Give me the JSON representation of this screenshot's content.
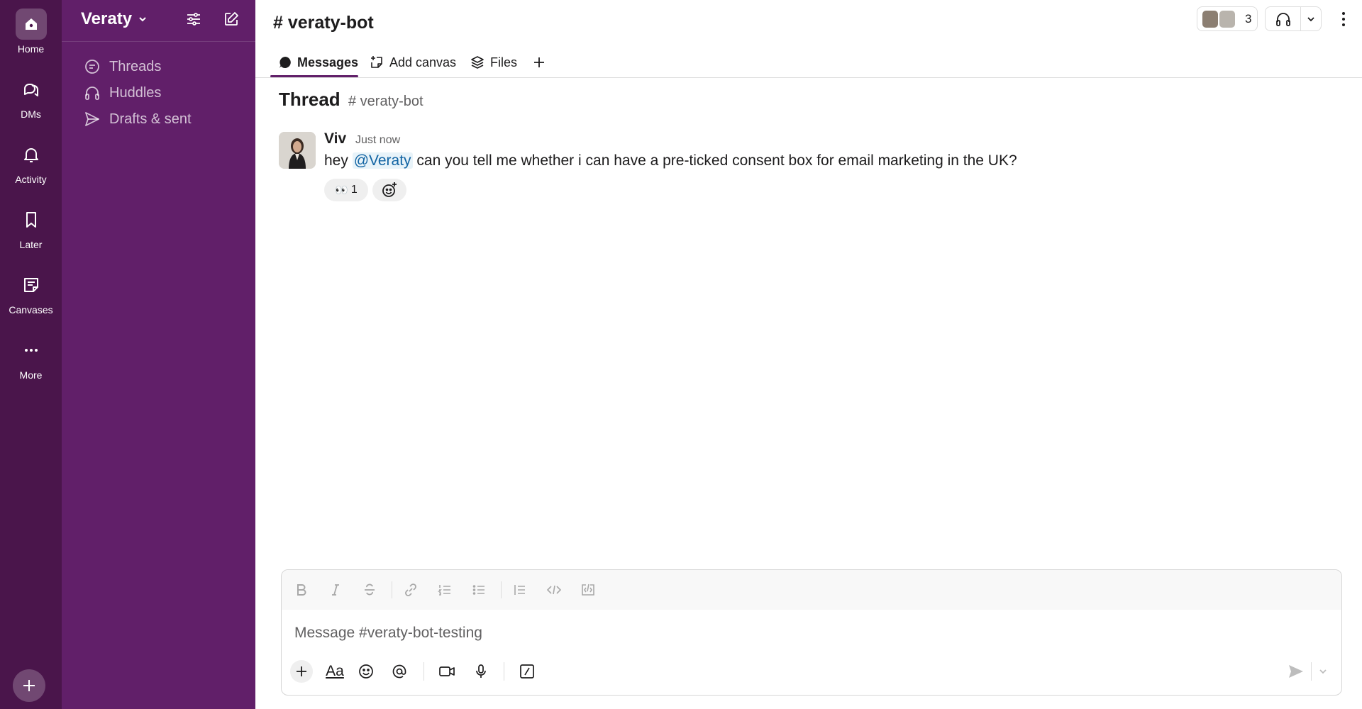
{
  "rail": {
    "items": [
      {
        "label": "Home",
        "icon": "home-icon"
      },
      {
        "label": "DMs",
        "icon": "dms-icon"
      },
      {
        "label": "Activity",
        "icon": "bell-icon"
      },
      {
        "label": "Later",
        "icon": "bookmark-icon"
      },
      {
        "label": "Canvases",
        "icon": "canvas-icon"
      },
      {
        "label": "More",
        "icon": "more-icon"
      }
    ],
    "add_icon": "plus-icon"
  },
  "sidebar": {
    "workspace_name": "Veraty",
    "items": [
      {
        "label": "Threads",
        "icon": "threads-icon"
      },
      {
        "label": "Huddles",
        "icon": "headphones-icon"
      },
      {
        "label": "Drafts & sent",
        "icon": "send-icon"
      }
    ]
  },
  "header": {
    "channel_title": "# veraty-bot",
    "member_count": "3"
  },
  "tabs": [
    {
      "label": "Messages",
      "icon": "message-icon"
    },
    {
      "label": "Add canvas",
      "icon": "add-canvas-icon"
    },
    {
      "label": "Files",
      "icon": "files-icon"
    }
  ],
  "thread": {
    "title": "Thread",
    "channel": "# veraty-bot"
  },
  "message": {
    "author": "Viv",
    "time": "Just now",
    "text_before": "hey ",
    "mention": "@Veraty",
    "text_after": " can you tell me whether i can have a pre-ticked consent box for email marketing in the UK?",
    "reaction": {
      "emoji": "👀",
      "count": "1"
    }
  },
  "composer": {
    "placeholder": "Message #veraty-bot-testing",
    "format_label": "Aa"
  },
  "colors": {
    "rail_bg": "#4a154b",
    "sidebar_bg": "#611f69",
    "mention_text": "#1264a3",
    "mention_bg": "#e8f3f9"
  }
}
